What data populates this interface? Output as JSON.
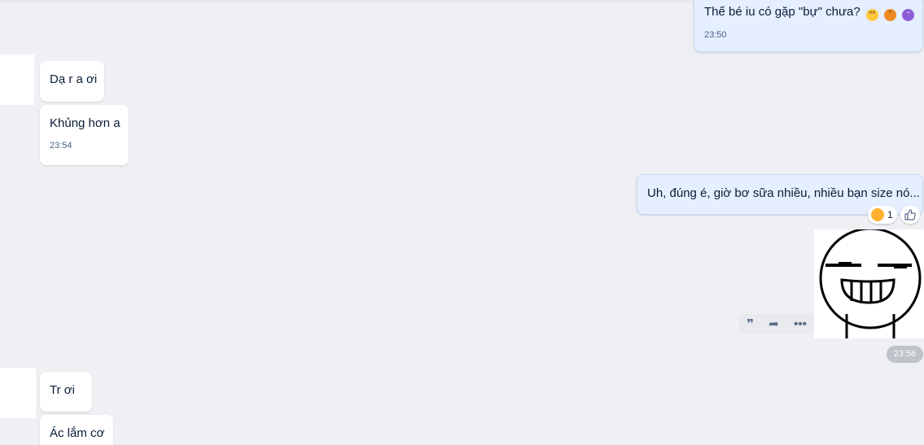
{
  "messages": {
    "m1": {
      "text": "Thế bé iu có gặp \"bự\" chưa?",
      "time": "23:50"
    },
    "m2": {
      "text": "Dạ r a ơi"
    },
    "m3": {
      "text": "Khủng hơn a",
      "time": "23:54"
    },
    "m4": {
      "text": "Uh, đúng é, giờ bơ sữa nhiều, nhiều bạn size nó..."
    },
    "m5": {
      "text": "Tr ơi"
    },
    "m6": {
      "text": "Ác lắm cơ"
    }
  },
  "reaction": {
    "count": "1"
  },
  "sticker": {
    "time": "23:56"
  },
  "icons": {
    "emoji_1": "flushed-face-emoji",
    "emoji_2": "hot-face-emoji",
    "emoji_3": "smiling-devil-emoji",
    "reaction": "laughing-face-icon",
    "like": "thumbs-up-icon",
    "quote": "quote-icon",
    "forward": "forward-icon",
    "more": "more-icon"
  },
  "colors": {
    "background": "#eff0f3",
    "bubble_in": "#ffffff",
    "bubble_out": "#e5efff",
    "text": "#081c36",
    "time": "#476285"
  }
}
